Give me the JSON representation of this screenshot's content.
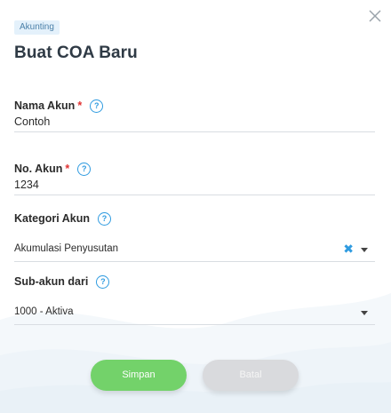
{
  "header": {
    "badge": "Akunting",
    "title": "Buat COA Baru"
  },
  "fields": {
    "nama_akun": {
      "label": "Nama Akun",
      "required": "*",
      "value": "Contoh"
    },
    "no_akun": {
      "label": "No. Akun",
      "required": "*",
      "value": "1234"
    },
    "kategori_akun": {
      "label": "Kategori Akun",
      "value": "Akumulasi Penyusutan",
      "clear": "✖"
    },
    "sub_akun": {
      "label": "Sub-akun dari",
      "value": "1000 - Aktiva"
    }
  },
  "help_glyph": "?",
  "buttons": {
    "save": "Simpan",
    "cancel": "Batal"
  },
  "colors": {
    "accent": "#2f9be0",
    "save": "#73d26a",
    "cancel": "#d9dadd",
    "required": "#e03131",
    "badge_bg": "#e4f1fb"
  },
  "icons": {
    "close": "close-icon",
    "help": "help-icon",
    "clear": "clear-icon",
    "dropdown": "chevron-down-icon"
  }
}
